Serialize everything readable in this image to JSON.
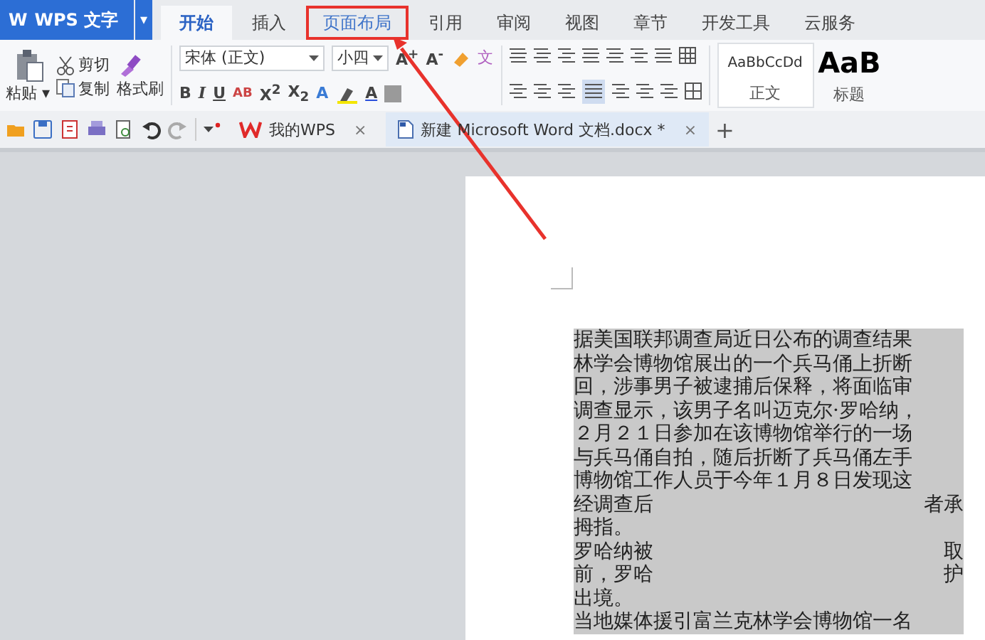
{
  "app": {
    "logo": "W",
    "title": "WPS 文字",
    "menu_caret": "▾"
  },
  "tabs": [
    {
      "label": "开始",
      "selected": true,
      "annotated": false
    },
    {
      "label": "插入",
      "selected": false,
      "annotated": false
    },
    {
      "label": "页面布局",
      "selected": false,
      "annotated": true
    },
    {
      "label": "引用",
      "selected": false,
      "annotated": false
    },
    {
      "label": "审阅",
      "selected": false,
      "annotated": false
    },
    {
      "label": "视图",
      "selected": false,
      "annotated": false
    },
    {
      "label": "章节",
      "selected": false,
      "annotated": false
    },
    {
      "label": "开发工具",
      "selected": false,
      "annotated": false
    },
    {
      "label": "云服务",
      "selected": false,
      "annotated": false
    }
  ],
  "clipboard": {
    "paste": "粘贴",
    "paste_caret": "▾",
    "cut": "剪切",
    "copy": "复制",
    "format_painter": "格式刷"
  },
  "font": {
    "family": "宋体 (正文)",
    "size": "小四",
    "grow": "A$^{+}$",
    "shrink": "A$^{-}$",
    "pinyin": "文",
    "styles": [
      "B",
      "I",
      "U",
      "AB",
      "X$^{2}$",
      "X$_{2}$",
      "A",
      "A"
    ]
  },
  "styles_gallery": [
    {
      "preview": "AaBbCcDd",
      "name": "正文",
      "kind": "small"
    },
    {
      "preview": "AaB",
      "name": "标题",
      "kind": "large"
    }
  ],
  "doc_tabs": [
    {
      "label": "我的WPS",
      "close": "×",
      "selected": false
    },
    {
      "label": "新建 Microsoft Word 文档.docx *",
      "close": "×",
      "selected": true
    }
  ],
  "new_tab": "+",
  "document": {
    "lines": [
      {
        "segments": [
          "据美国联邦调查局近日公布的调查结果"
        ]
      },
      {
        "segments": [
          "林学会博物馆展出的一个兵马俑上折断"
        ]
      },
      {
        "segments": [
          "回，涉事男子被逮捕后保释，将面临审"
        ]
      },
      {
        "segments": [
          "调查显示，该男子名叫迈克尔·罗哈纳，"
        ]
      },
      {
        "segments": [
          "２月２１日参加在该博物馆举行的一场"
        ]
      },
      {
        "segments": [
          "与兵马俑自拍，随后折断了兵马俑左手"
        ]
      },
      {
        "segments": [
          "博物馆工作人员于今年１月８日发现这"
        ]
      },
      {
        "segments": [
          "经调查后",
          "者承"
        ]
      },
      {
        "segments": [
          "拇指。"
        ]
      },
      {
        "segments": [
          "罗哈纳被",
          "取"
        ]
      },
      {
        "segments": [
          "前，罗哈",
          "护"
        ]
      },
      {
        "segments": [
          "出境。"
        ]
      },
      {
        "segments": [
          "当地媒体援引富兰克林学会博物馆一名"
        ]
      }
    ]
  }
}
